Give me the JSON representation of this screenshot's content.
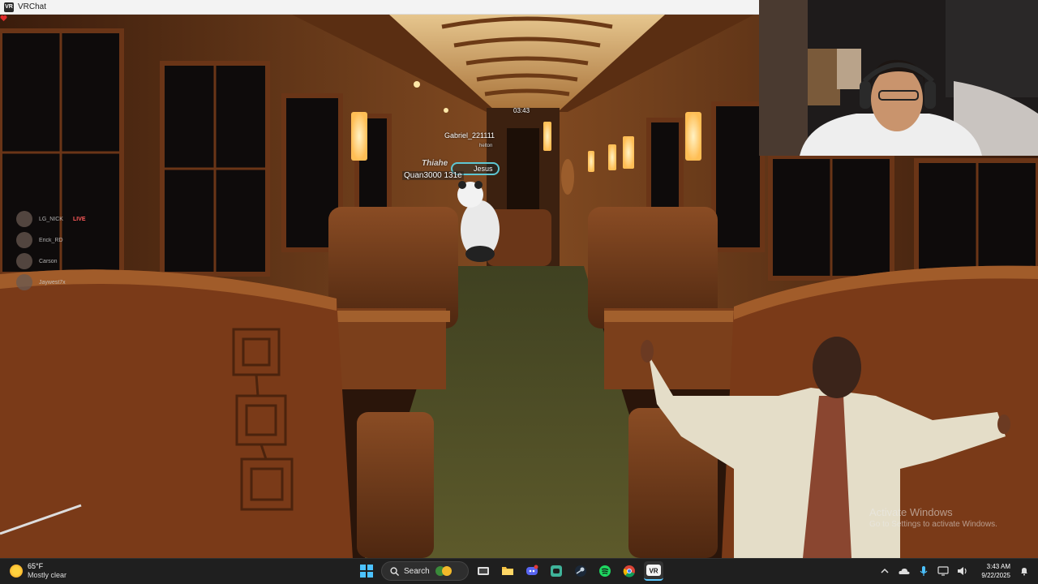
{
  "window": {
    "title": "VRChat"
  },
  "game": {
    "nameplates": {
      "time": "03:43",
      "gabriel": "Gabriel_221111",
      "gabriel_sub": "helton",
      "thiahe": "Thiahe",
      "jesus": "Jesus",
      "quan": "Quan3000 131e"
    },
    "friends": [
      {
        "name": "LG_NICK",
        "badge": "LIVE"
      },
      {
        "name": "Erick_RD",
        "badge": ""
      },
      {
        "name": "Carson",
        "badge": ""
      },
      {
        "name": "Jaywest7x",
        "badge": ""
      }
    ]
  },
  "watermark": {
    "line1": "Activate Windows",
    "line2": "Go to Settings to activate Windows."
  },
  "taskbar": {
    "weather": {
      "temp": "65°F",
      "condition": "Mostly clear"
    },
    "search_label": "Search",
    "clock": {
      "time": "3:43 AM",
      "date": "9/22/2025"
    },
    "icons": [
      "windows-start-icon",
      "search-icon",
      "widgets-icon",
      "task-view-icon",
      "file-explorer-icon",
      "discord-icon",
      "xbox-icon",
      "steam-icon",
      "spotify-icon",
      "chrome-icon",
      "vrchat-icon"
    ]
  },
  "colors": {
    "accent": "#5cc8ff",
    "wood": "#7a3f1c",
    "carpet": "#4c4a22"
  }
}
